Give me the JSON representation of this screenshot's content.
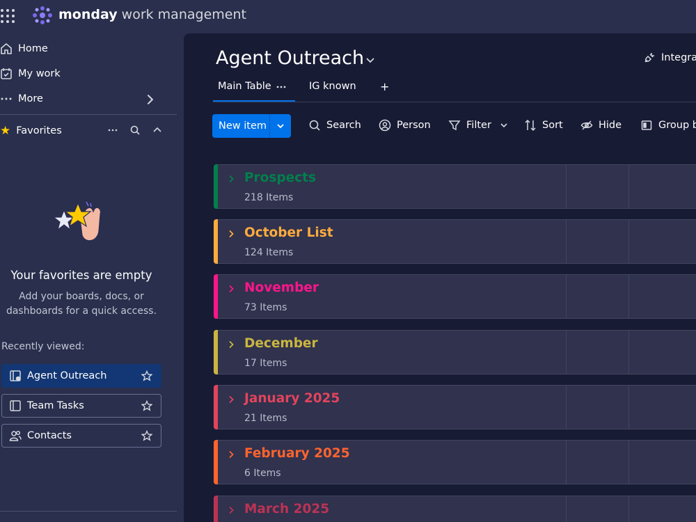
{
  "topbar": {
    "brand_bold": "monday",
    "brand_rest": " work management"
  },
  "sidebar": {
    "nav": [
      {
        "label": "Home",
        "icon": "home-icon"
      },
      {
        "label": "My work",
        "icon": "calendar-check-icon"
      },
      {
        "label": "More",
        "icon": "more-dots-icon"
      }
    ],
    "favorites": {
      "label": "Favorites",
      "empty_title": "Your favorites are empty",
      "empty_sub_line1": "Add your boards, docs, or",
      "empty_sub_line2": "dashboards for a quick access."
    },
    "recent_label": "Recently viewed:",
    "recent": [
      {
        "label": "Agent Outreach",
        "icon": "board-icon",
        "active": true
      },
      {
        "label": "Team Tasks",
        "icon": "board-icon",
        "active": false
      },
      {
        "label": "Contacts",
        "icon": "people-icon",
        "active": false
      }
    ]
  },
  "board": {
    "title": "Agent Outreach",
    "integrate": "Integrat",
    "tabs": [
      {
        "label": "Main Table",
        "active": true
      },
      {
        "label": "IG known",
        "active": false
      },
      {
        "label": "+",
        "active": false
      }
    ],
    "toolbar": {
      "new_item": "New item",
      "search": "Search",
      "person": "Person",
      "filter": "Filter",
      "sort": "Sort",
      "hide": "Hide",
      "group_by": "Group b"
    },
    "groups": [
      {
        "name": "Prospects",
        "count": "218 Items",
        "color": "#037f4c"
      },
      {
        "name": "October List",
        "count": "124 Items",
        "color": "#fdab3d"
      },
      {
        "name": "November",
        "count": "73 Items",
        "color": "#ff158a"
      },
      {
        "name": "December",
        "count": "17 Items",
        "color": "#cab641"
      },
      {
        "name": "January 2025",
        "count": "21 Items",
        "color": "#e2445c"
      },
      {
        "name": "February 2025",
        "count": "6 Items",
        "color": "#ff642e"
      },
      {
        "name": "March 2025",
        "count": "",
        "color": "#bb3354"
      }
    ]
  },
  "colors": {
    "accent": "#0073ea",
    "background": "#292f4c",
    "board_background": "#181b34"
  }
}
